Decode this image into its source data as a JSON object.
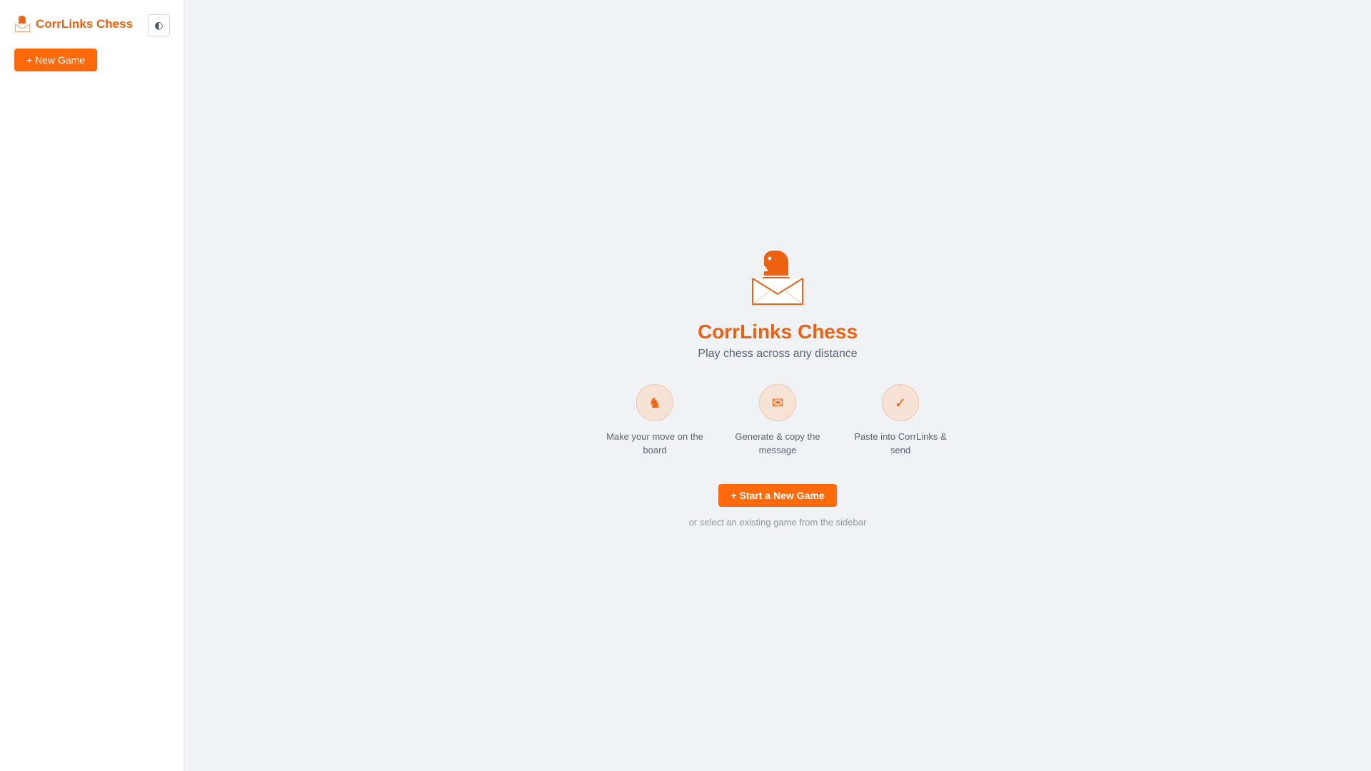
{
  "colors": {
    "accent": "#ff6a0d",
    "brand_text": "#ec6210",
    "main_background": "#f0f2f5",
    "sidebar_background": "#ffffff",
    "step_circle_background": "#f7e2d6"
  },
  "sidebar": {
    "brand_icon": "knight-envelope-logo-icon",
    "brand_title": "CorrLinks Chess",
    "theme_toggle_icon": "contrast-icon",
    "theme_toggle_glyph": "◐",
    "new_game_label": "+ New Game"
  },
  "main": {
    "hero_icon": "knight-envelope-logo-icon",
    "title": "CorrLinks Chess",
    "subtitle": "Play chess across any distance",
    "steps": [
      {
        "icon": "knight-icon",
        "glyph": "♞",
        "label": "Make your move on the board"
      },
      {
        "icon": "envelope-icon",
        "glyph": "✉",
        "label": "Generate & copy the message"
      },
      {
        "icon": "checkmark-icon",
        "glyph": "✓",
        "label": "Paste into CorrLinks & send"
      }
    ],
    "start_button_label": "+ Start a New Game",
    "hint": "or select an existing game from the sidebar"
  }
}
